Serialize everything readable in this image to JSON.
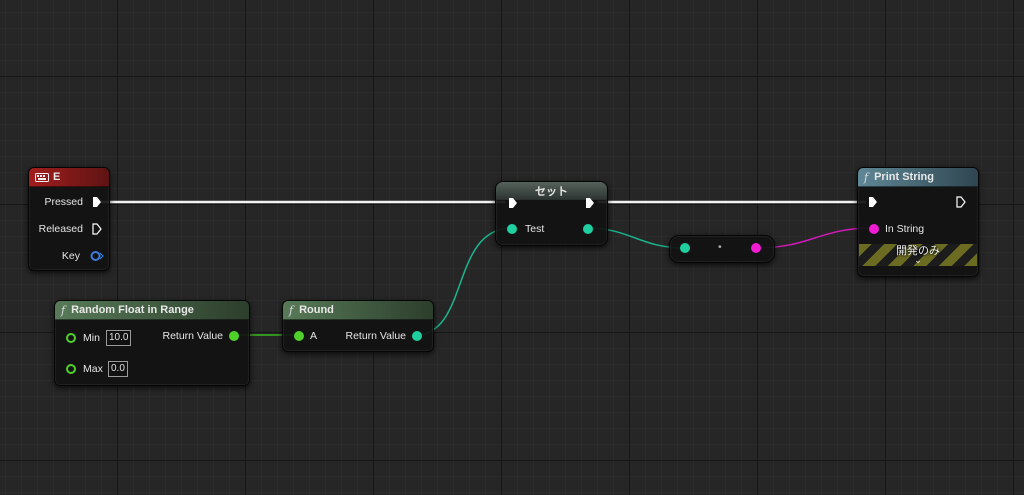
{
  "nodes": {
    "event_e": {
      "title": "E",
      "header_color": "#8c1a1a",
      "pins": {
        "pressed": "Pressed",
        "released": "Released",
        "key": "Key"
      }
    },
    "set": {
      "title": "セット",
      "pins": {
        "test": "Test"
      }
    },
    "print_string": {
      "title": "Print String",
      "pins": {
        "in_string": "In String"
      },
      "dev_only_label": "開発のみ"
    },
    "random_float": {
      "title": "Random Float in Range",
      "pins": {
        "min": "Min",
        "max": "Max",
        "return_value": "Return Value"
      },
      "min_value": "10.0",
      "max_value": "0.0"
    },
    "round": {
      "title": "Round",
      "pins": {
        "a": "A",
        "return_value": "Return Value"
      }
    },
    "conversion": {
      "label": "•"
    }
  },
  "colors": {
    "exec_wire": "#ffffff",
    "float_pin": "#4fd12a",
    "int_pin": "#1fcfa0",
    "string_pin": "#f01bd2",
    "key_pin": "#3a7ad9",
    "event_header": "#8c1a1a",
    "function_header": "#5a7a86",
    "pure_header": "#4f6d4f",
    "canvas_bg": "#262626"
  },
  "icons": {
    "keyboard": "keyboard-icon",
    "function": "function-icon",
    "exec": "exec-pin-icon",
    "expand": "chevron-down-icon"
  }
}
